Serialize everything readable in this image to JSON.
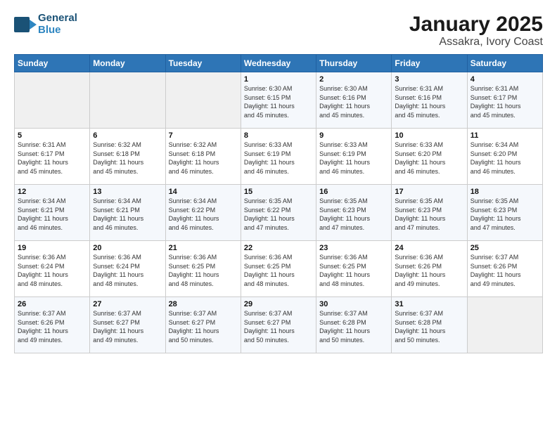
{
  "logo": {
    "line1": "General",
    "line2": "Blue"
  },
  "title": "January 2025",
  "subtitle": "Assakra, Ivory Coast",
  "days_of_week": [
    "Sunday",
    "Monday",
    "Tuesday",
    "Wednesday",
    "Thursday",
    "Friday",
    "Saturday"
  ],
  "weeks": [
    [
      {
        "num": "",
        "info": ""
      },
      {
        "num": "",
        "info": ""
      },
      {
        "num": "",
        "info": ""
      },
      {
        "num": "1",
        "info": "Sunrise: 6:30 AM\nSunset: 6:15 PM\nDaylight: 11 hours\nand 45 minutes."
      },
      {
        "num": "2",
        "info": "Sunrise: 6:30 AM\nSunset: 6:16 PM\nDaylight: 11 hours\nand 45 minutes."
      },
      {
        "num": "3",
        "info": "Sunrise: 6:31 AM\nSunset: 6:16 PM\nDaylight: 11 hours\nand 45 minutes."
      },
      {
        "num": "4",
        "info": "Sunrise: 6:31 AM\nSunset: 6:17 PM\nDaylight: 11 hours\nand 45 minutes."
      }
    ],
    [
      {
        "num": "5",
        "info": "Sunrise: 6:31 AM\nSunset: 6:17 PM\nDaylight: 11 hours\nand 45 minutes."
      },
      {
        "num": "6",
        "info": "Sunrise: 6:32 AM\nSunset: 6:18 PM\nDaylight: 11 hours\nand 45 minutes."
      },
      {
        "num": "7",
        "info": "Sunrise: 6:32 AM\nSunset: 6:18 PM\nDaylight: 11 hours\nand 46 minutes."
      },
      {
        "num": "8",
        "info": "Sunrise: 6:33 AM\nSunset: 6:19 PM\nDaylight: 11 hours\nand 46 minutes."
      },
      {
        "num": "9",
        "info": "Sunrise: 6:33 AM\nSunset: 6:19 PM\nDaylight: 11 hours\nand 46 minutes."
      },
      {
        "num": "10",
        "info": "Sunrise: 6:33 AM\nSunset: 6:20 PM\nDaylight: 11 hours\nand 46 minutes."
      },
      {
        "num": "11",
        "info": "Sunrise: 6:34 AM\nSunset: 6:20 PM\nDaylight: 11 hours\nand 46 minutes."
      }
    ],
    [
      {
        "num": "12",
        "info": "Sunrise: 6:34 AM\nSunset: 6:21 PM\nDaylight: 11 hours\nand 46 minutes."
      },
      {
        "num": "13",
        "info": "Sunrise: 6:34 AM\nSunset: 6:21 PM\nDaylight: 11 hours\nand 46 minutes."
      },
      {
        "num": "14",
        "info": "Sunrise: 6:34 AM\nSunset: 6:22 PM\nDaylight: 11 hours\nand 46 minutes."
      },
      {
        "num": "15",
        "info": "Sunrise: 6:35 AM\nSunset: 6:22 PM\nDaylight: 11 hours\nand 47 minutes."
      },
      {
        "num": "16",
        "info": "Sunrise: 6:35 AM\nSunset: 6:23 PM\nDaylight: 11 hours\nand 47 minutes."
      },
      {
        "num": "17",
        "info": "Sunrise: 6:35 AM\nSunset: 6:23 PM\nDaylight: 11 hours\nand 47 minutes."
      },
      {
        "num": "18",
        "info": "Sunrise: 6:35 AM\nSunset: 6:23 PM\nDaylight: 11 hours\nand 47 minutes."
      }
    ],
    [
      {
        "num": "19",
        "info": "Sunrise: 6:36 AM\nSunset: 6:24 PM\nDaylight: 11 hours\nand 48 minutes."
      },
      {
        "num": "20",
        "info": "Sunrise: 6:36 AM\nSunset: 6:24 PM\nDaylight: 11 hours\nand 48 minutes."
      },
      {
        "num": "21",
        "info": "Sunrise: 6:36 AM\nSunset: 6:25 PM\nDaylight: 11 hours\nand 48 minutes."
      },
      {
        "num": "22",
        "info": "Sunrise: 6:36 AM\nSunset: 6:25 PM\nDaylight: 11 hours\nand 48 minutes."
      },
      {
        "num": "23",
        "info": "Sunrise: 6:36 AM\nSunset: 6:25 PM\nDaylight: 11 hours\nand 48 minutes."
      },
      {
        "num": "24",
        "info": "Sunrise: 6:36 AM\nSunset: 6:26 PM\nDaylight: 11 hours\nand 49 minutes."
      },
      {
        "num": "25",
        "info": "Sunrise: 6:37 AM\nSunset: 6:26 PM\nDaylight: 11 hours\nand 49 minutes."
      }
    ],
    [
      {
        "num": "26",
        "info": "Sunrise: 6:37 AM\nSunset: 6:26 PM\nDaylight: 11 hours\nand 49 minutes."
      },
      {
        "num": "27",
        "info": "Sunrise: 6:37 AM\nSunset: 6:27 PM\nDaylight: 11 hours\nand 49 minutes."
      },
      {
        "num": "28",
        "info": "Sunrise: 6:37 AM\nSunset: 6:27 PM\nDaylight: 11 hours\nand 50 minutes."
      },
      {
        "num": "29",
        "info": "Sunrise: 6:37 AM\nSunset: 6:27 PM\nDaylight: 11 hours\nand 50 minutes."
      },
      {
        "num": "30",
        "info": "Sunrise: 6:37 AM\nSunset: 6:28 PM\nDaylight: 11 hours\nand 50 minutes."
      },
      {
        "num": "31",
        "info": "Sunrise: 6:37 AM\nSunset: 6:28 PM\nDaylight: 11 hours\nand 50 minutes."
      },
      {
        "num": "",
        "info": ""
      }
    ]
  ]
}
